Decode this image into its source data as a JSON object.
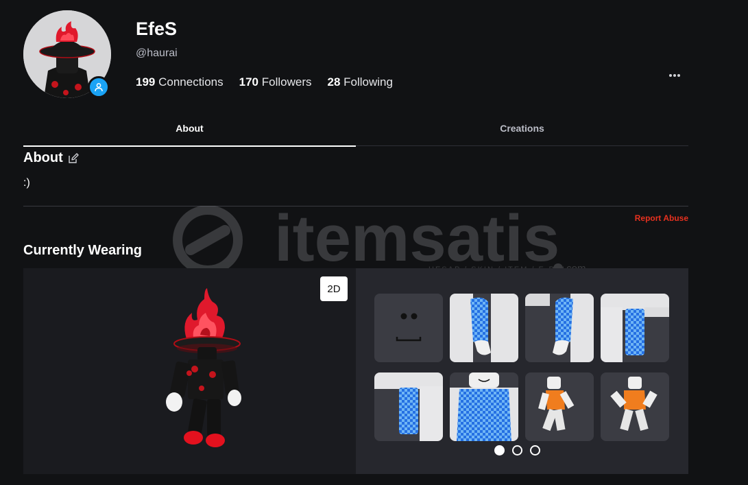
{
  "profile": {
    "display_name": "EfeS",
    "username": "@haurai",
    "stats": [
      {
        "count": "199",
        "label": "Connections"
      },
      {
        "count": "170",
        "label": "Followers"
      },
      {
        "count": "28",
        "label": "Following"
      }
    ],
    "more_icon": "ellipsis-icon",
    "presence_icon": "user-icon"
  },
  "tabs": [
    {
      "label": "About",
      "active": true
    },
    {
      "label": "Creations",
      "active": false
    }
  ],
  "about": {
    "heading": "About",
    "text": ":)",
    "edit_icon": "edit-icon",
    "report_label": "Report Abuse"
  },
  "watermark": {
    "brand": "itemsatis",
    "tagline": "HESAP / SKIN / ITEM / E-PIN",
    "domain": ".com"
  },
  "currently_wearing": {
    "heading": "Currently Wearing",
    "toggle_label": "2D",
    "items": [
      {
        "name": "face-item"
      },
      {
        "name": "right-arm-item"
      },
      {
        "name": "left-arm-item"
      },
      {
        "name": "right-leg-item"
      },
      {
        "name": "left-leg-item"
      },
      {
        "name": "torso-item"
      },
      {
        "name": "animation-item-1"
      },
      {
        "name": "animation-item-2"
      }
    ],
    "pages": 3,
    "current_page": 1
  },
  "colors": {
    "background": "#111214",
    "accent_blue": "#1aa3f5",
    "report_red": "#e8311f",
    "panel": "#26272d"
  }
}
